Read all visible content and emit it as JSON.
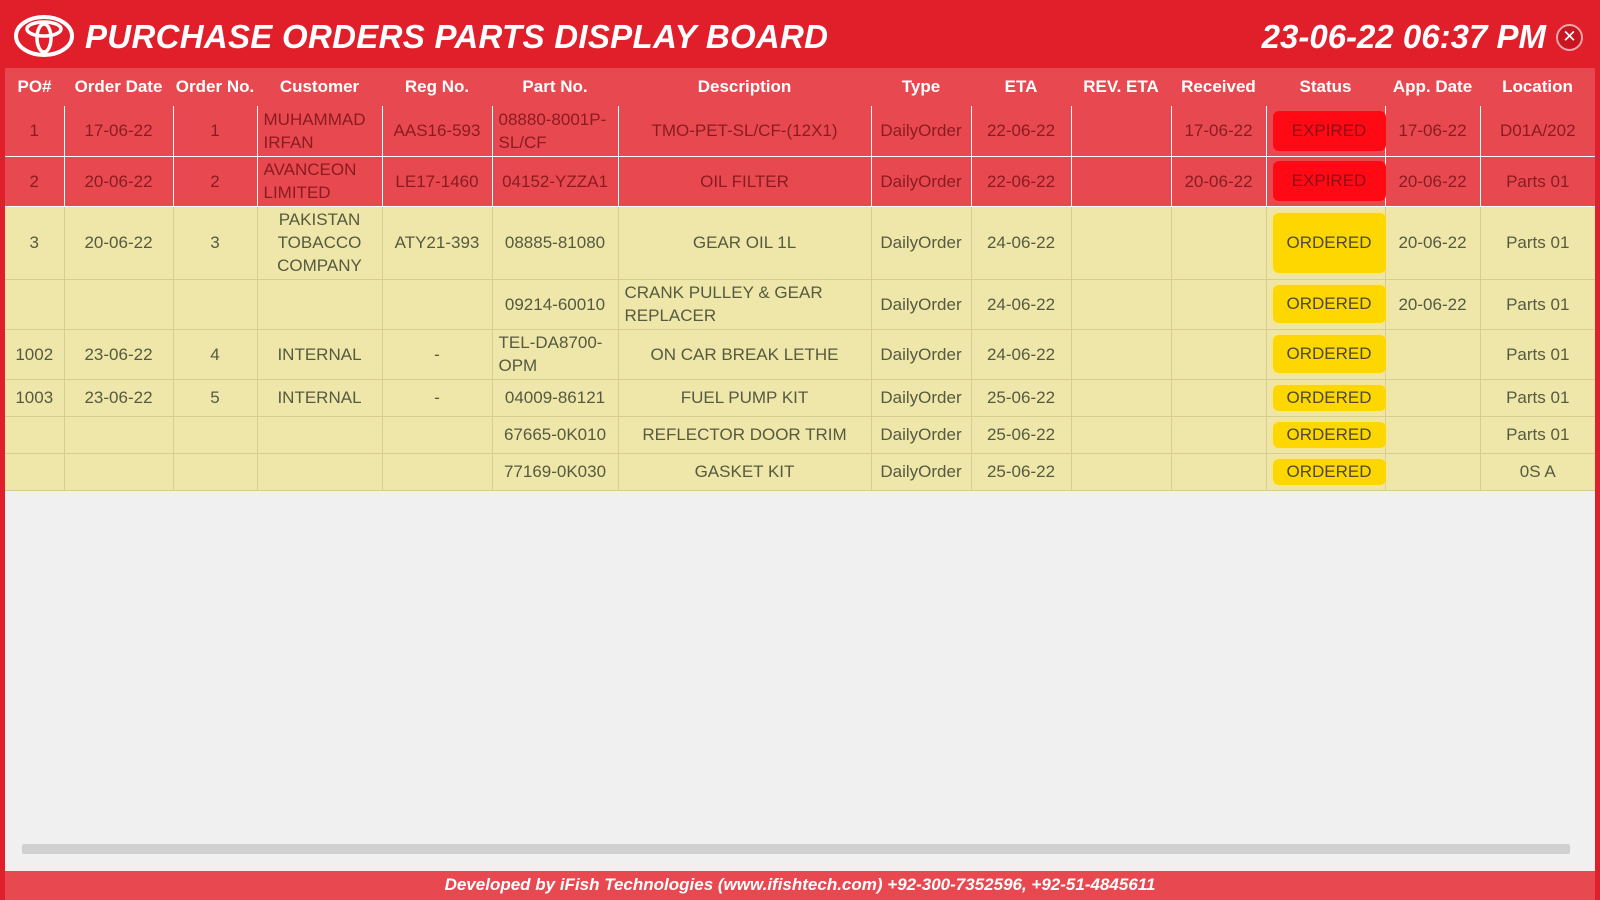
{
  "header": {
    "title": "PURCHASE ORDERS PARTS DISPLAY BOARD",
    "datetime": "23-06-22 06:37 PM",
    "close_label": "✕",
    "brand_color": "#e01f2b"
  },
  "table": {
    "columns": [
      "PO#",
      "Order Date",
      "Order No.",
      "Customer",
      "Reg No.",
      "Part No.",
      "Description",
      "Type",
      "ETA",
      "REV. ETA",
      "Received",
      "Status",
      "App. Date",
      "Location"
    ],
    "rows": [
      {
        "po": "1",
        "order_date": "17-06-22",
        "order_no": "1",
        "customer": "MUHAMMAD IRFAN",
        "reg_no": "AAS16-593",
        "part_no": "08880-8001P-SL/CF",
        "description": "TMO-PET-SL/CF-(12X1)",
        "type": "DailyOrder",
        "eta": "22-06-22",
        "rev_eta": "",
        "received": "17-06-22",
        "status": "EXPIRED",
        "app_date": "17-06-22",
        "location": "D01A/202"
      },
      {
        "po": "2",
        "order_date": "20-06-22",
        "order_no": "2",
        "customer": "AVANCEON LIMITED",
        "reg_no": "LE17-1460",
        "part_no": "04152-YZZA1",
        "description": "OIL FILTER",
        "type": "DailyOrder",
        "eta": "22-06-22",
        "rev_eta": "",
        "received": "20-06-22",
        "status": "EXPIRED",
        "app_date": "20-06-22",
        "location": "Parts 01"
      },
      {
        "po": "3",
        "order_date": "20-06-22",
        "order_no": "3",
        "customer": "PAKISTAN TOBACCO COMPANY",
        "reg_no": "ATY21-393",
        "part_no": "08885-81080",
        "description": "GEAR OIL 1L",
        "type": "DailyOrder",
        "eta": "24-06-22",
        "rev_eta": "",
        "received": "",
        "status": "ORDERED",
        "app_date": "20-06-22",
        "location": "Parts 01"
      },
      {
        "po": "",
        "order_date": "",
        "order_no": "",
        "customer": "",
        "reg_no": "",
        "part_no": "09214-60010",
        "description": "CRANK PULLEY & GEAR REPLACER",
        "type": "DailyOrder",
        "eta": "24-06-22",
        "rev_eta": "",
        "received": "",
        "status": "ORDERED",
        "app_date": "20-06-22",
        "location": "Parts 01"
      },
      {
        "po": "1002",
        "order_date": "23-06-22",
        "order_no": "4",
        "customer": "INTERNAL",
        "reg_no": "-",
        "part_no": "TEL-DA8700-OPM",
        "description": "ON CAR BREAK LETHE",
        "type": "DailyOrder",
        "eta": "24-06-22",
        "rev_eta": "",
        "received": "",
        "status": "ORDERED",
        "app_date": "",
        "location": "Parts 01"
      },
      {
        "po": "1003",
        "order_date": "23-06-22",
        "order_no": "5",
        "customer": "INTERNAL",
        "reg_no": "-",
        "part_no": "04009-86121",
        "description": "FUEL PUMP KIT",
        "type": "DailyOrder",
        "eta": "25-06-22",
        "rev_eta": "",
        "received": "",
        "status": "ORDERED",
        "app_date": "",
        "location": "Parts 01"
      },
      {
        "po": "",
        "order_date": "",
        "order_no": "",
        "customer": "",
        "reg_no": "",
        "part_no": "67665-0K010",
        "description": "REFLECTOR DOOR TRIM",
        "type": "DailyOrder",
        "eta": "25-06-22",
        "rev_eta": "",
        "received": "",
        "status": "ORDERED",
        "app_date": "",
        "location": "Parts 01"
      },
      {
        "po": "",
        "order_date": "",
        "order_no": "",
        "customer": "",
        "reg_no": "",
        "part_no": "77169-0K030",
        "description": "GASKET KIT",
        "type": "DailyOrder",
        "eta": "25-06-22",
        "rev_eta": "",
        "received": "",
        "status": "ORDERED",
        "app_date": "",
        "location": "0S A"
      }
    ]
  },
  "status_colors": {
    "EXPIRED": "#ff0a14",
    "ORDERED": "#ffd700"
  },
  "footer": {
    "text": "Developed by iFish Technologies (www.ifishtech.com) +92-300-7352596, +92-51-4845611"
  }
}
